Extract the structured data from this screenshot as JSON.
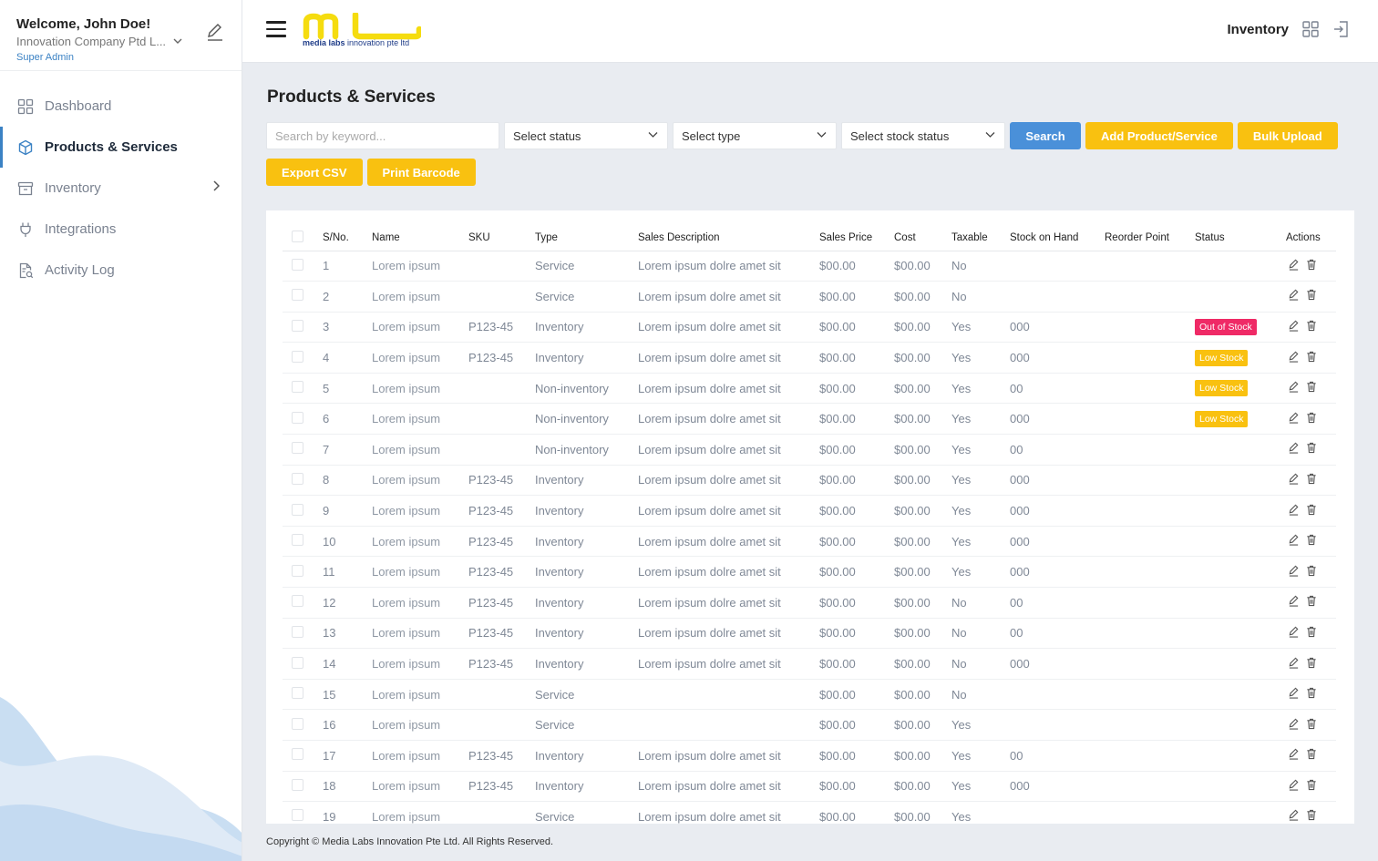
{
  "user": {
    "welcome": "Welcome, John Doe!",
    "company": "Innovation Company Ptd L...",
    "role": "Super Admin"
  },
  "nav": {
    "items": [
      {
        "label": "Dashboard",
        "icon": "dashboard-icon"
      },
      {
        "label": "Products & Services",
        "icon": "box-icon"
      },
      {
        "label": "Inventory",
        "icon": "archive-icon"
      },
      {
        "label": "Integrations",
        "icon": "plug-icon"
      },
      {
        "label": "Activity Log",
        "icon": "log-icon"
      }
    ]
  },
  "header": {
    "logo_sub_bold": "media labs",
    "logo_sub_rest": " innovation pte ltd",
    "title": "Inventory"
  },
  "page": {
    "title": "Products & Services"
  },
  "filters": {
    "search_placeholder": "Search by keyword...",
    "status": "Select status",
    "type": "Select type",
    "stock_status": "Select stock status",
    "search_btn": "Search",
    "add_btn": "Add Product/Service",
    "bulk_btn": "Bulk Upload",
    "export_btn": "Export CSV",
    "barcode_btn": "Print Barcode"
  },
  "table": {
    "columns": [
      "S/No.",
      "Name",
      "SKU",
      "Type",
      "Sales Description",
      "Sales Price",
      "Cost",
      "Taxable",
      "Stock on Hand",
      "Reorder Point",
      "Status",
      "Actions"
    ],
    "rows": [
      {
        "sno": "1",
        "name": "Lorem ipsum",
        "sku": "",
        "type": "Service",
        "desc": "Lorem ipsum dolre amet sit",
        "price": "$00.00",
        "cost": "$00.00",
        "taxable": "No",
        "stock": "",
        "reorder": "",
        "status": ""
      },
      {
        "sno": "2",
        "name": "Lorem ipsum",
        "sku": "",
        "type": "Service",
        "desc": "Lorem ipsum dolre amet sit",
        "price": "$00.00",
        "cost": "$00.00",
        "taxable": "No",
        "stock": "",
        "reorder": "",
        "status": ""
      },
      {
        "sno": "3",
        "name": "Lorem ipsum",
        "sku": "P123-45",
        "type": "Inventory",
        "desc": "Lorem ipsum dolre amet sit",
        "price": "$00.00",
        "cost": "$00.00",
        "taxable": "Yes",
        "stock": "000",
        "reorder": "",
        "status": "Out of Stock"
      },
      {
        "sno": "4",
        "name": "Lorem ipsum",
        "sku": "P123-45",
        "type": "Inventory",
        "desc": "Lorem ipsum dolre amet sit",
        "price": "$00.00",
        "cost": "$00.00",
        "taxable": "Yes",
        "stock": "000",
        "reorder": "",
        "status": "Low Stock"
      },
      {
        "sno": "5",
        "name": "Lorem ipsum",
        "sku": "",
        "type": "Non-inventory",
        "desc": "Lorem ipsum dolre amet sit",
        "price": "$00.00",
        "cost": "$00.00",
        "taxable": "Yes",
        "stock": "00",
        "reorder": "",
        "status": "Low Stock"
      },
      {
        "sno": "6",
        "name": "Lorem ipsum",
        "sku": "",
        "type": "Non-inventory",
        "desc": "Lorem ipsum dolre amet sit",
        "price": "$00.00",
        "cost": "$00.00",
        "taxable": "Yes",
        "stock": "000",
        "reorder": "",
        "status": "Low Stock"
      },
      {
        "sno": "7",
        "name": "Lorem ipsum",
        "sku": "",
        "type": "Non-inventory",
        "desc": "Lorem ipsum dolre amet sit",
        "price": "$00.00",
        "cost": "$00.00",
        "taxable": "Yes",
        "stock": "00",
        "reorder": "",
        "status": ""
      },
      {
        "sno": "8",
        "name": "Lorem ipsum",
        "sku": "P123-45",
        "type": "Inventory",
        "desc": "Lorem ipsum dolre amet sit",
        "price": "$00.00",
        "cost": "$00.00",
        "taxable": "Yes",
        "stock": "000",
        "reorder": "",
        "status": ""
      },
      {
        "sno": "9",
        "name": "Lorem ipsum",
        "sku": "P123-45",
        "type": "Inventory",
        "desc": "Lorem ipsum dolre amet sit",
        "price": "$00.00",
        "cost": "$00.00",
        "taxable": "Yes",
        "stock": "000",
        "reorder": "",
        "status": ""
      },
      {
        "sno": "10",
        "name": "Lorem ipsum",
        "sku": "P123-45",
        "type": "Inventory",
        "desc": "Lorem ipsum dolre amet sit",
        "price": "$00.00",
        "cost": "$00.00",
        "taxable": "Yes",
        "stock": "000",
        "reorder": "",
        "status": ""
      },
      {
        "sno": "11",
        "name": "Lorem ipsum",
        "sku": "P123-45",
        "type": "Inventory",
        "desc": "Lorem ipsum dolre amet sit",
        "price": "$00.00",
        "cost": "$00.00",
        "taxable": "Yes",
        "stock": "000",
        "reorder": "",
        "status": ""
      },
      {
        "sno": "12",
        "name": "Lorem ipsum",
        "sku": "P123-45",
        "type": "Inventory",
        "desc": "Lorem ipsum dolre amet sit",
        "price": "$00.00",
        "cost": "$00.00",
        "taxable": "No",
        "stock": "00",
        "reorder": "",
        "status": ""
      },
      {
        "sno": "13",
        "name": "Lorem ipsum",
        "sku": "P123-45",
        "type": "Inventory",
        "desc": "Lorem ipsum dolre amet sit",
        "price": "$00.00",
        "cost": "$00.00",
        "taxable": "No",
        "stock": "00",
        "reorder": "",
        "status": ""
      },
      {
        "sno": "14",
        "name": "Lorem ipsum",
        "sku": "P123-45",
        "type": "Inventory",
        "desc": "Lorem ipsum dolre amet sit",
        "price": "$00.00",
        "cost": "$00.00",
        "taxable": "No",
        "stock": "000",
        "reorder": "",
        "status": ""
      },
      {
        "sno": "15",
        "name": "Lorem ipsum",
        "sku": "",
        "type": "Service",
        "desc": "",
        "price": "$00.00",
        "cost": "$00.00",
        "taxable": "No",
        "stock": "",
        "reorder": "",
        "status": ""
      },
      {
        "sno": "16",
        "name": "Lorem ipsum",
        "sku": "",
        "type": "Service",
        "desc": "",
        "price": "$00.00",
        "cost": "$00.00",
        "taxable": "Yes",
        "stock": "",
        "reorder": "",
        "status": ""
      },
      {
        "sno": "17",
        "name": "Lorem ipsum",
        "sku": "P123-45",
        "type": "Inventory",
        "desc": "Lorem ipsum dolre amet sit",
        "price": "$00.00",
        "cost": "$00.00",
        "taxable": "Yes",
        "stock": "00",
        "reorder": "",
        "status": ""
      },
      {
        "sno": "18",
        "name": "Lorem ipsum",
        "sku": "P123-45",
        "type": "Inventory",
        "desc": "Lorem ipsum dolre amet sit",
        "price": "$00.00",
        "cost": "$00.00",
        "taxable": "Yes",
        "stock": "000",
        "reorder": "",
        "status": ""
      },
      {
        "sno": "19",
        "name": "Lorem ipsum",
        "sku": "",
        "type": "Service",
        "desc": "Lorem ipsum dolre amet sit",
        "price": "$00.00",
        "cost": "$00.00",
        "taxable": "Yes",
        "stock": "",
        "reorder": "",
        "status": ""
      }
    ]
  },
  "status_colors": {
    "Out of Stock": "#ef2a66",
    "Low Stock": "#f9c110"
  },
  "colors": {
    "accent": "#3b82c4",
    "brand_yellow": "#f9c110",
    "search_blue": "#4a90d9"
  },
  "footer": {
    "copyright": "Copyright © Media Labs Innovation Pte Ltd. All Rights Reserved."
  }
}
